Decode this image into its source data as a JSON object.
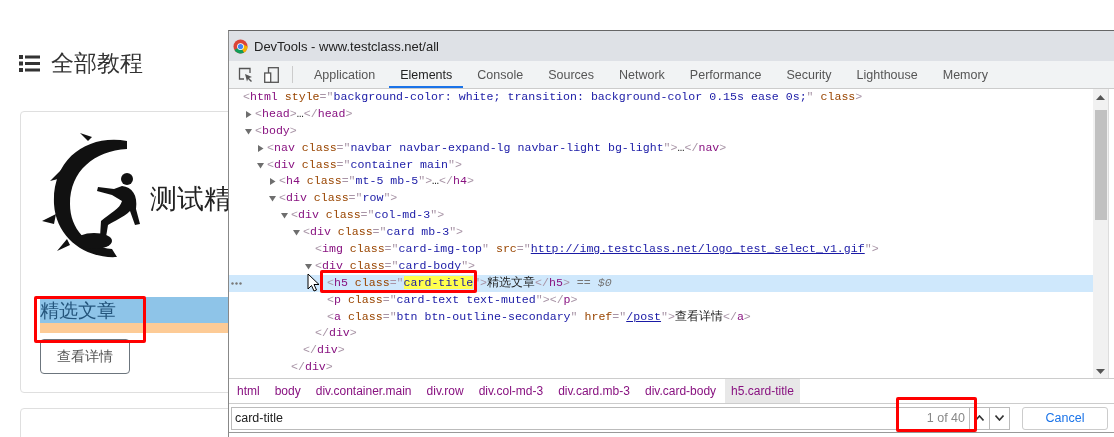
{
  "page": {
    "heading": "全部教程",
    "card": {
      "logo_text": "测试精",
      "title": "精选文章",
      "button": "查看详情"
    }
  },
  "devtools": {
    "title": "DevTools - www.testclass.net/all",
    "tabs": [
      {
        "label": "Application",
        "selected": false
      },
      {
        "label": "Elements",
        "selected": true
      },
      {
        "label": "Console",
        "selected": false
      },
      {
        "label": "Sources",
        "selected": false
      },
      {
        "label": "Network",
        "selected": false
      },
      {
        "label": "Performance",
        "selected": false
      },
      {
        "label": "Security",
        "selected": false
      },
      {
        "label": "Lighthouse",
        "selected": false
      },
      {
        "label": "Memory",
        "selected": false
      }
    ],
    "tree": [
      {
        "selected": false,
        "line": [
          {
            "kind": "punct",
            "text": "<"
          },
          {
            "kind": "tag",
            "text": "html"
          },
          {
            "kind": "attr",
            "text": " style"
          },
          {
            "kind": "punct",
            "text": "=\""
          },
          {
            "kind": "value",
            "text": "background-color: white; transition: background-color 0.15s ease 0s;"
          },
          {
            "kind": "punct",
            "text": "\""
          },
          {
            "kind": "attr",
            "text": " class"
          },
          {
            "kind": "punct",
            "text": ">"
          }
        ],
        "children": [
          {
            "selected": false,
            "expanded": false,
            "line": [
              {
                "kind": "punct",
                "text": "<"
              },
              {
                "kind": "tag",
                "text": "head"
              },
              {
                "kind": "punct",
                "text": ">"
              },
              {
                "kind": "plain",
                "text": "…"
              },
              {
                "kind": "punct",
                "text": "</"
              },
              {
                "kind": "tag",
                "text": "head"
              },
              {
                "kind": "punct",
                "text": ">"
              }
            ]
          },
          {
            "selected": false,
            "expanded": true,
            "line": [
              {
                "kind": "punct",
                "text": "<"
              },
              {
                "kind": "tag",
                "text": "body"
              },
              {
                "kind": "punct",
                "text": ">"
              }
            ],
            "children": [
              {
                "selected": false,
                "expanded": false,
                "line": [
                  {
                    "kind": "punct",
                    "text": "<"
                  },
                  {
                    "kind": "tag",
                    "text": "nav"
                  },
                  {
                    "kind": "attr",
                    "text": " class"
                  },
                  {
                    "kind": "punct",
                    "text": "=\""
                  },
                  {
                    "kind": "value",
                    "text": "navbar navbar-expand-lg navbar-light bg-light"
                  },
                  {
                    "kind": "punct",
                    "text": "\">"
                  },
                  {
                    "kind": "plain",
                    "text": "…"
                  },
                  {
                    "kind": "punct",
                    "text": "</"
                  },
                  {
                    "kind": "tag",
                    "text": "nav"
                  },
                  {
                    "kind": "punct",
                    "text": ">"
                  }
                ]
              },
              {
                "selected": false,
                "expanded": true,
                "line": [
                  {
                    "kind": "punct",
                    "text": "<"
                  },
                  {
                    "kind": "tag",
                    "text": "div"
                  },
                  {
                    "kind": "attr",
                    "text": " class"
                  },
                  {
                    "kind": "punct",
                    "text": "=\""
                  },
                  {
                    "kind": "value",
                    "text": "container main"
                  },
                  {
                    "kind": "punct",
                    "text": "\">"
                  }
                ],
                "children": [
                  {
                    "selected": false,
                    "expanded": false,
                    "line": [
                      {
                        "kind": "punct",
                        "text": "<"
                      },
                      {
                        "kind": "tag",
                        "text": "h4"
                      },
                      {
                        "kind": "attr",
                        "text": " class"
                      },
                      {
                        "kind": "punct",
                        "text": "=\""
                      },
                      {
                        "kind": "value",
                        "text": "mt-5 mb-5"
                      },
                      {
                        "kind": "punct",
                        "text": "\">"
                      },
                      {
                        "kind": "plain",
                        "text": "…"
                      },
                      {
                        "kind": "punct",
                        "text": "</"
                      },
                      {
                        "kind": "tag",
                        "text": "h4"
                      },
                      {
                        "kind": "punct",
                        "text": ">"
                      }
                    ]
                  },
                  {
                    "selected": false,
                    "expanded": true,
                    "line": [
                      {
                        "kind": "punct",
                        "text": "<"
                      },
                      {
                        "kind": "tag",
                        "text": "div"
                      },
                      {
                        "kind": "attr",
                        "text": " class"
                      },
                      {
                        "kind": "punct",
                        "text": "=\""
                      },
                      {
                        "kind": "value",
                        "text": "row"
                      },
                      {
                        "kind": "punct",
                        "text": "\">"
                      }
                    ],
                    "children": [
                      {
                        "selected": false,
                        "expanded": true,
                        "line": [
                          {
                            "kind": "punct",
                            "text": "<"
                          },
                          {
                            "kind": "tag",
                            "text": "div"
                          },
                          {
                            "kind": "attr",
                            "text": " class"
                          },
                          {
                            "kind": "punct",
                            "text": "=\""
                          },
                          {
                            "kind": "value",
                            "text": "col-md-3"
                          },
                          {
                            "kind": "punct",
                            "text": "\">"
                          }
                        ],
                        "close": [
                          {
                            "kind": "punct",
                            "text": "</"
                          },
                          {
                            "kind": "tag",
                            "text": "div"
                          },
                          {
                            "kind": "punct",
                            "text": ">"
                          }
                        ],
                        "children": [
                          {
                            "selected": false,
                            "expanded": true,
                            "line": [
                              {
                                "kind": "punct",
                                "text": "<"
                              },
                              {
                                "kind": "tag",
                                "text": "div"
                              },
                              {
                                "kind": "attr",
                                "text": " class"
                              },
                              {
                                "kind": "punct",
                                "text": "=\""
                              },
                              {
                                "kind": "value",
                                "text": "card mb-3"
                              },
                              {
                                "kind": "punct",
                                "text": "\">"
                              }
                            ],
                            "close": [
                              {
                                "kind": "punct",
                                "text": "</"
                              },
                              {
                                "kind": "tag",
                                "text": "div"
                              },
                              {
                                "kind": "punct",
                                "text": ">"
                              }
                            ],
                            "children": [
                              {
                                "selected": false,
                                "line": [
                                  {
                                    "kind": "punct",
                                    "text": "<"
                                  },
                                  {
                                    "kind": "tag",
                                    "text": "img"
                                  },
                                  {
                                    "kind": "attr",
                                    "text": " class"
                                  },
                                  {
                                    "kind": "punct",
                                    "text": "=\""
                                  },
                                  {
                                    "kind": "value",
                                    "text": "card-img-top"
                                  },
                                  {
                                    "kind": "punct",
                                    "text": "\""
                                  },
                                  {
                                    "kind": "attr",
                                    "text": " src"
                                  },
                                  {
                                    "kind": "punct",
                                    "text": "=\""
                                  },
                                  {
                                    "kind": "link",
                                    "text": "http://img.testclass.net/logo_test_select_v1.gif"
                                  },
                                  {
                                    "kind": "punct",
                                    "text": "\">"
                                  }
                                ]
                              },
                              {
                                "selected": false,
                                "expanded": true,
                                "line": [
                                  {
                                    "kind": "punct",
                                    "text": "<"
                                  },
                                  {
                                    "kind": "tag",
                                    "text": "div"
                                  },
                                  {
                                    "kind": "attr",
                                    "text": " class"
                                  },
                                  {
                                    "kind": "punct",
                                    "text": "=\""
                                  },
                                  {
                                    "kind": "value",
                                    "text": "card-body"
                                  },
                                  {
                                    "kind": "punct",
                                    "text": "\">"
                                  }
                                ],
                                "close": [
                                  {
                                    "kind": "punct",
                                    "text": "</"
                                  },
                                  {
                                    "kind": "tag",
                                    "text": "div"
                                  },
                                  {
                                    "kind": "punct",
                                    "text": ">"
                                  }
                                ],
                                "children": [
                                  {
                                    "selected": true,
                                    "line": [
                                      {
                                        "kind": "punct",
                                        "text": "<"
                                      },
                                      {
                                        "kind": "tag",
                                        "text": "h5"
                                      },
                                      {
                                        "kind": "attr",
                                        "text": " class"
                                      },
                                      {
                                        "kind": "punct",
                                        "text": "=\""
                                      },
                                      {
                                        "kind": "match",
                                        "text": "card-title"
                                      },
                                      {
                                        "kind": "punct",
                                        "text": "\">"
                                      },
                                      {
                                        "kind": "plain",
                                        "text": "精选文章"
                                      },
                                      {
                                        "kind": "punct",
                                        "text": "</"
                                      },
                                      {
                                        "kind": "tag",
                                        "text": "h5"
                                      },
                                      {
                                        "kind": "punct",
                                        "text": ">"
                                      },
                                      {
                                        "kind": "ref",
                                        "text": " == $0"
                                      }
                                    ]
                                  },
                                  {
                                    "selected": false,
                                    "line": [
                                      {
                                        "kind": "punct",
                                        "text": "<"
                                      },
                                      {
                                        "kind": "tag",
                                        "text": "p"
                                      },
                                      {
                                        "kind": "attr",
                                        "text": " class"
                                      },
                                      {
                                        "kind": "punct",
                                        "text": "=\""
                                      },
                                      {
                                        "kind": "value",
                                        "text": "card-text text-muted"
                                      },
                                      {
                                        "kind": "punct",
                                        "text": "\">"
                                      },
                                      {
                                        "kind": "punct",
                                        "text": "</"
                                      },
                                      {
                                        "kind": "tag",
                                        "text": "p"
                                      },
                                      {
                                        "kind": "punct",
                                        "text": ">"
                                      }
                                    ]
                                  },
                                  {
                                    "selected": false,
                                    "line": [
                                      {
                                        "kind": "punct",
                                        "text": "<"
                                      },
                                      {
                                        "kind": "tag",
                                        "text": "a"
                                      },
                                      {
                                        "kind": "attr",
                                        "text": " class"
                                      },
                                      {
                                        "kind": "punct",
                                        "text": "=\""
                                      },
                                      {
                                        "kind": "value",
                                        "text": "btn btn-outline-secondary"
                                      },
                                      {
                                        "kind": "punct",
                                        "text": "\""
                                      },
                                      {
                                        "kind": "attr",
                                        "text": " href"
                                      },
                                      {
                                        "kind": "punct",
                                        "text": "=\""
                                      },
                                      {
                                        "kind": "link",
                                        "text": "/post"
                                      },
                                      {
                                        "kind": "punct",
                                        "text": "\">"
                                      },
                                      {
                                        "kind": "plain",
                                        "text": "查看详情"
                                      },
                                      {
                                        "kind": "punct",
                                        "text": "</"
                                      },
                                      {
                                        "kind": "tag",
                                        "text": "a"
                                      },
                                      {
                                        "kind": "punct",
                                        "text": ">"
                                      }
                                    ]
                                  }
                                ]
                              }
                            ]
                          }
                        ]
                      }
                    ]
                  }
                ]
              }
            ]
          }
        ]
      }
    ],
    "breadcrumbs": [
      {
        "label": "html",
        "selected": false
      },
      {
        "label": "body",
        "selected": false
      },
      {
        "label": "div.container.main",
        "selected": false
      },
      {
        "label": "div.row",
        "selected": false
      },
      {
        "label": "div.col-md-3",
        "selected": false
      },
      {
        "label": "div.card.mb-3",
        "selected": false
      },
      {
        "label": "div.card-body",
        "selected": false
      },
      {
        "label": "h5.card-title",
        "selected": true
      }
    ],
    "search": {
      "value": "card-title",
      "count": "1 of 40",
      "cancel": "Cancel"
    }
  }
}
